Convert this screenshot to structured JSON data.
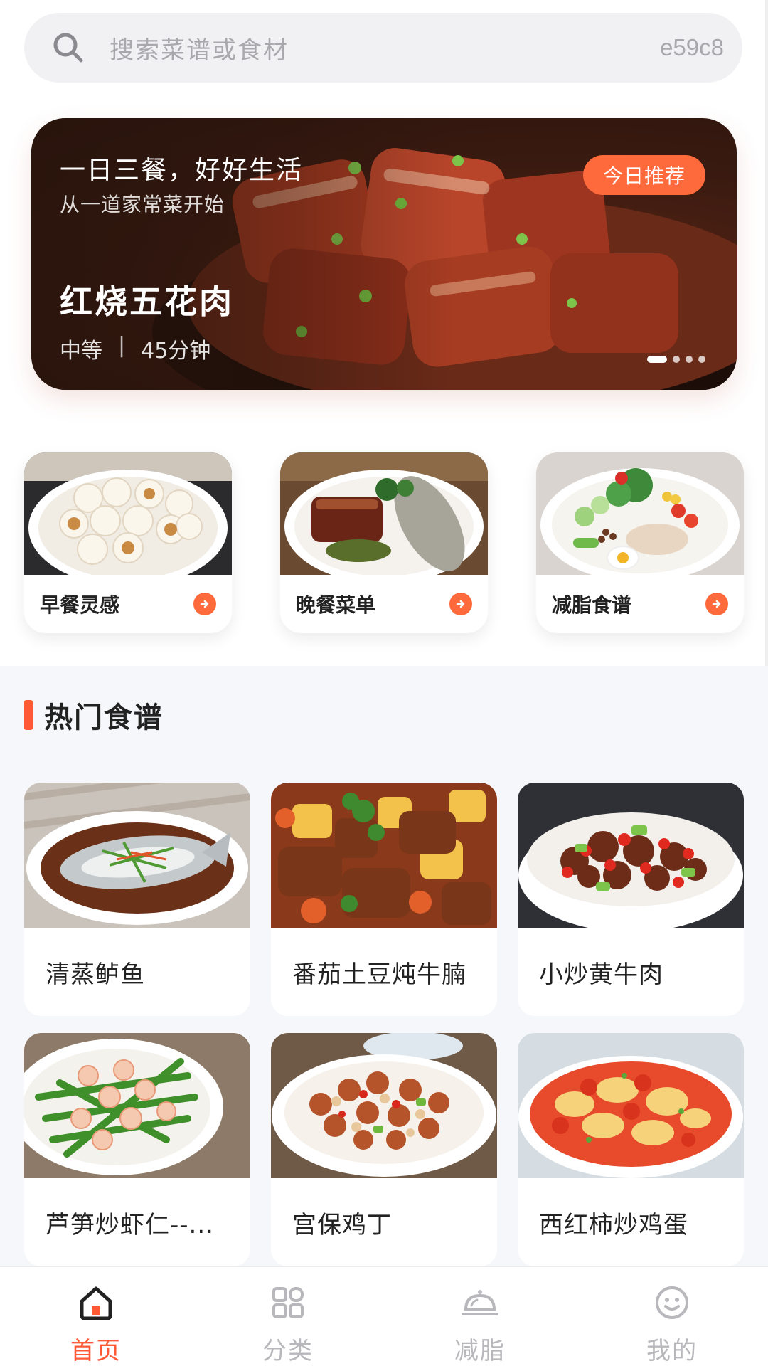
{
  "search": {
    "placeholder": "搜索菜谱或食材",
    "code": "e59c8"
  },
  "banner": {
    "slogan": "一日三餐，好好生活",
    "subtitle": "从一道家常菜开始",
    "badge": "今日推荐",
    "dish": "红烧五花肉",
    "difficulty": "中等",
    "separator": "|",
    "duration": "45分钟",
    "page_count": 4,
    "active_page": 1
  },
  "categories": [
    {
      "label": "早餐灵感",
      "icon": "arrow-right-icon"
    },
    {
      "label": "晚餐菜单",
      "icon": "arrow-right-icon"
    },
    {
      "label": "减脂食谱",
      "icon": "arrow-right-icon"
    }
  ],
  "section": {
    "title": "热门食谱"
  },
  "recipes": [
    {
      "name": "清蒸鲈鱼"
    },
    {
      "name": "番茄土豆炖牛腩"
    },
    {
      "name": "小炒黄牛肉"
    },
    {
      "name": "芦笋炒虾仁--..."
    },
    {
      "name": "宫保鸡丁"
    },
    {
      "name": "西红柿炒鸡蛋"
    }
  ],
  "tabs": [
    {
      "label": "首页",
      "icon": "home-icon",
      "active": true
    },
    {
      "label": "分类",
      "icon": "grid-icon",
      "active": false
    },
    {
      "label": "减脂",
      "icon": "cloche-icon",
      "active": false
    },
    {
      "label": "我的",
      "icon": "smile-icon",
      "active": false
    }
  ],
  "colors": {
    "accent": "#ff5a36",
    "badge": "#ff6a3d",
    "section_bg": "#f6f7fb"
  }
}
